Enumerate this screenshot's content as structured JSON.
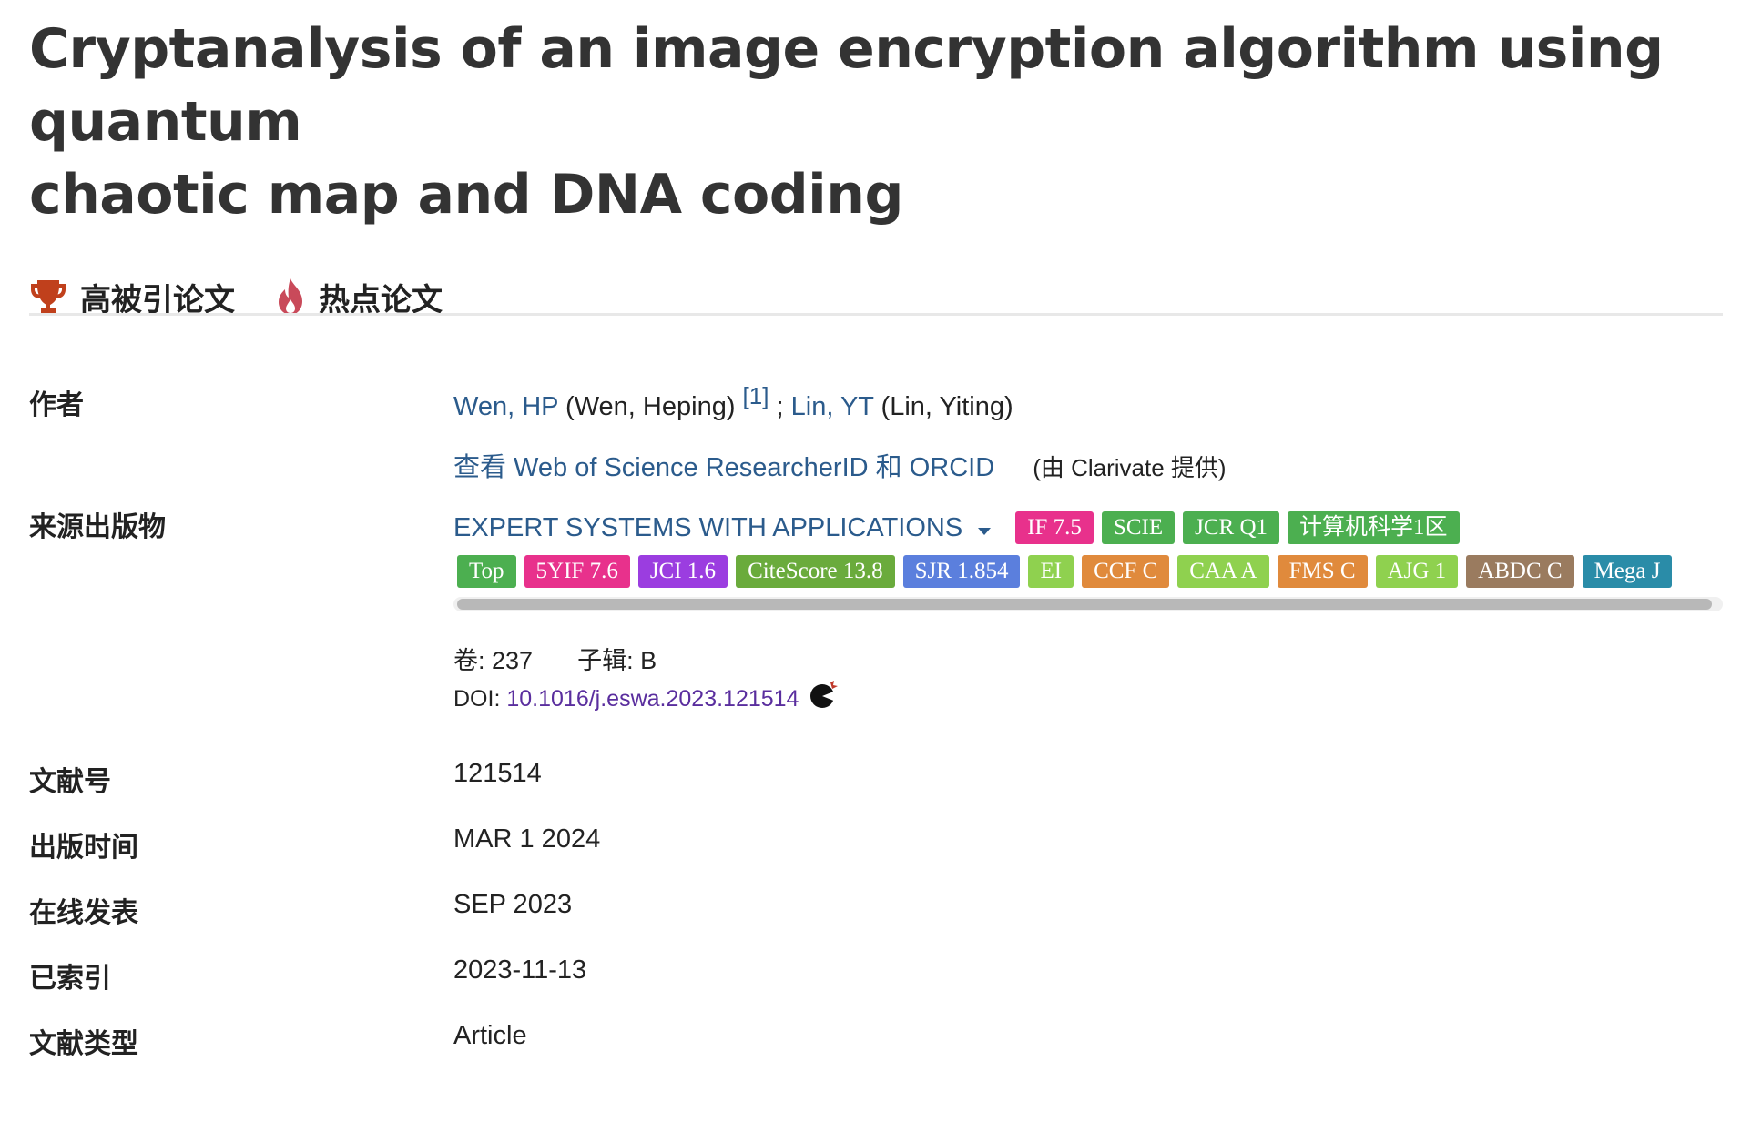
{
  "title_line1": "Cryptanalysis of an image encryption algorithm using quantum",
  "title_line2": "chaotic map and DNA coding",
  "badges": {
    "highly_cited": "高被引论文",
    "hot_paper": "热点论文"
  },
  "authors": {
    "label": "作者",
    "author1_short": "Wen, HP",
    "author1_full": "(Wen, Heping)",
    "author1_ref": "[1]",
    "separator": ";",
    "author2_short": "Lin, YT",
    "author2_full": "(Lin, Yiting)",
    "researcher_link": "查看 Web of Science ResearcherID 和 ORCID",
    "provided_by": "(由 Clarivate 提供)"
  },
  "source": {
    "label": "来源出版物",
    "journal": "EXPERT SYSTEMS WITH APPLICATIONS",
    "tags_row1": [
      {
        "text": "IF 7.5",
        "color": "#e8318c"
      },
      {
        "text": "SCIE",
        "color": "#4caf50"
      },
      {
        "text": "JCR Q1",
        "color": "#4caf50"
      },
      {
        "text": "计算机科学1区",
        "color": "#4caf50"
      }
    ],
    "tags_row2": [
      {
        "text": "Top",
        "color": "#4caf50"
      },
      {
        "text": "5YIF 7.6",
        "color": "#e8318c"
      },
      {
        "text": "JCI 1.6",
        "color": "#9b3de0"
      },
      {
        "text": "CiteScore 13.8",
        "color": "#6aab3c"
      },
      {
        "text": "SJR 1.854",
        "color": "#5b7fdd"
      },
      {
        "text": "EI",
        "color": "#8fd14f"
      },
      {
        "text": "CCF C",
        "color": "#e08a3c"
      },
      {
        "text": "CAA A",
        "color": "#8fd14f"
      },
      {
        "text": "FMS C",
        "color": "#e08a3c"
      },
      {
        "text": "AJG 1",
        "color": "#8fd14f"
      },
      {
        "text": "ABDC C",
        "color": "#9a7b5f"
      },
      {
        "text": "Mega J",
        "color": "#2a8ca8"
      }
    ],
    "volume": "卷: 237",
    "part": "子辑: B",
    "doi_label": "DOI:",
    "doi": "10.1016/j.eswa.2023.121514"
  },
  "article_number": {
    "label": "文献号",
    "value": "121514"
  },
  "published": {
    "label": "出版时间",
    "value": "MAR 1 2024"
  },
  "online": {
    "label": "在线发表",
    "value": "SEP 2023"
  },
  "indexed": {
    "label": "已索引",
    "value": "2023-11-13"
  },
  "doc_type": {
    "label": "文献类型",
    "value": "Article"
  },
  "icons": {
    "trophy": "trophy-icon",
    "flame": "flame-icon",
    "caret": "caret-down-icon",
    "sci_hub": "sci-hub-icon"
  }
}
